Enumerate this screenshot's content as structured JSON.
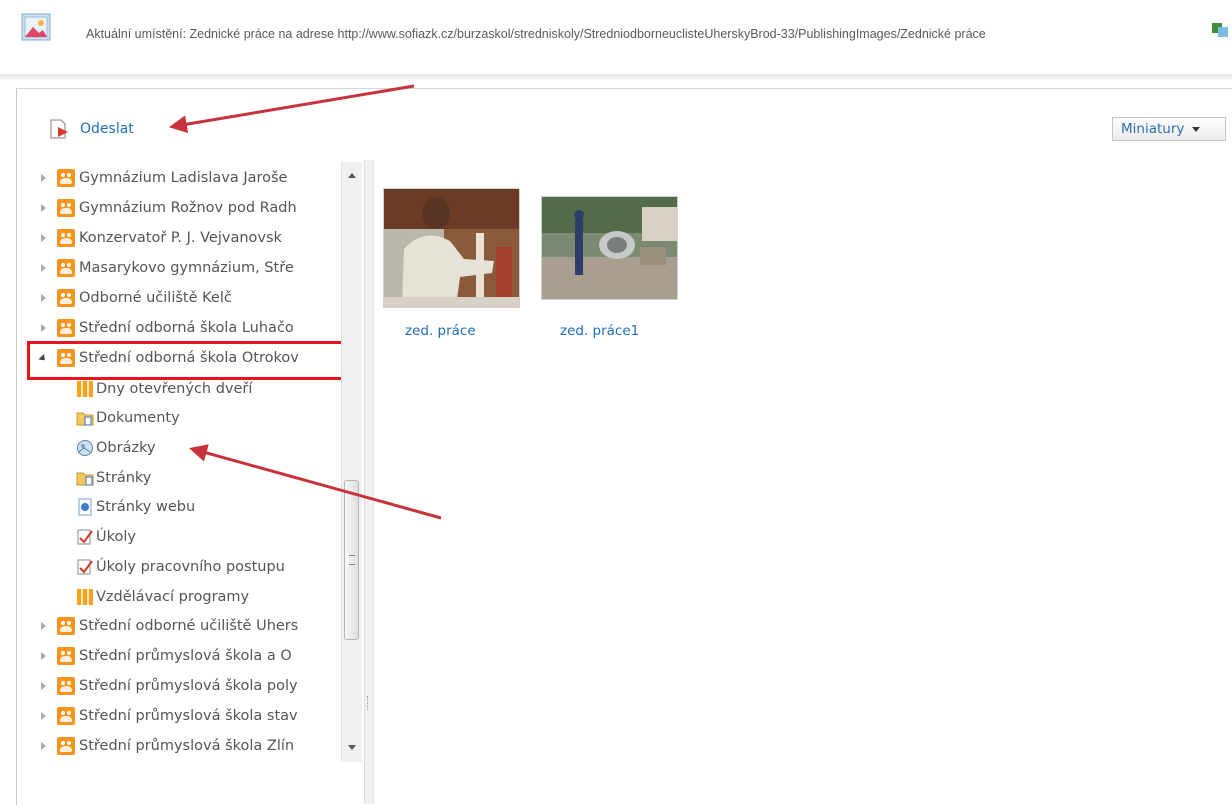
{
  "header": {
    "location_text": "Aktuální umístění: Zednické práce na adrese http://www.sofiazk.cz/burzaskol/stredniskoly/StredniodborneuclisteUherskyBrod-33/PublishingImages/Zednické práce",
    "location_icon": "image-icon"
  },
  "toolbar": {
    "send_label": "Odeslat",
    "send_icon": "send-icon",
    "view_label": "Miniatury"
  },
  "tree": {
    "items_top": [
      "Gymnázium Ladislava Jaroše",
      "Gymnázium Rožnov pod Radh",
      "Konzervatoř P. J. Vejvanovsk",
      "Masarykovo gymnázium, Stře",
      "Odborné učiliště Kelč",
      "Střední odborná škola Luhačo"
    ],
    "expanded_item": "Střední odborná škola Otrokov",
    "children": [
      {
        "label": "Dny otevřených dveří",
        "icon": "list-icon"
      },
      {
        "label": "Dokumenty",
        "icon": "document-library-icon"
      },
      {
        "label": "Obrázky",
        "icon": "picture-library-icon"
      },
      {
        "label": "Stránky",
        "icon": "pages-library-icon"
      },
      {
        "label": "Stránky webu",
        "icon": "site-pages-icon"
      },
      {
        "label": "Úkoly",
        "icon": "tasks-icon"
      },
      {
        "label": "Úkoly pracovního postupu",
        "icon": "tasks-icon"
      },
      {
        "label": "Vzdělávací programy",
        "icon": "list-icon"
      }
    ],
    "items_bottom": [
      "Střední odborné učiliště Uhers",
      "Střední průmyslová škola a O",
      "Střední průmyslová škola poly",
      "Střední průmyslová škola stav",
      "Střední průmyslová škola Zlín"
    ]
  },
  "gallery": {
    "items": [
      {
        "label": "zed. práce",
        "icon": "photo-thumbnail-icon"
      },
      {
        "label": "zed. práce1",
        "icon": "photo-thumbnail-icon"
      }
    ]
  },
  "colors": {
    "link": "#1e6fb8",
    "site_icon": "#f7941d",
    "annotation": "#c8323a",
    "highlight": "#e8141b"
  }
}
